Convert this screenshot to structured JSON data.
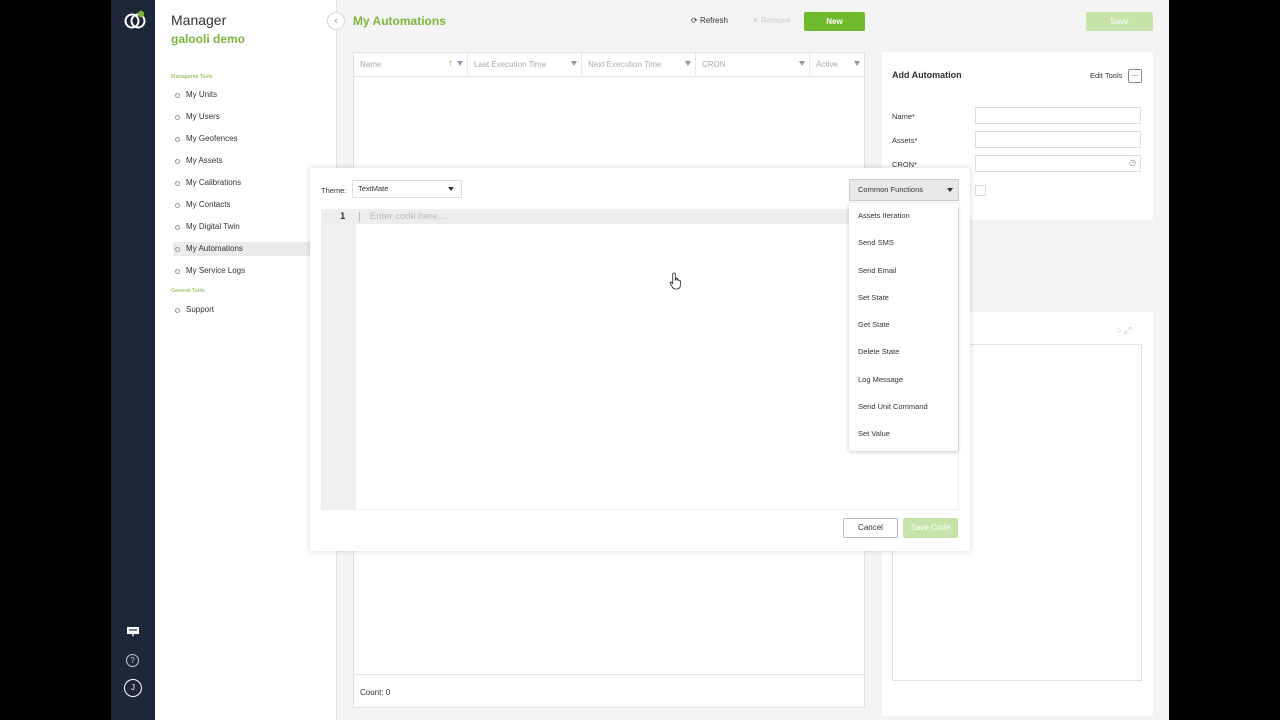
{
  "app": {
    "title": "Manager",
    "org": "galooli demo"
  },
  "nav": {
    "section_managerial": "Managerial Tools",
    "items": [
      {
        "label": "My Units"
      },
      {
        "label": "My Users"
      },
      {
        "label": "My Geofences"
      },
      {
        "label": "My Assets"
      },
      {
        "label": "My Calibrations"
      },
      {
        "label": "My Contacts"
      },
      {
        "label": "My Digital Twin"
      },
      {
        "label": "My Automations"
      },
      {
        "label": "My Service Logs"
      }
    ],
    "section_general": "General Tools",
    "general_items": [
      {
        "label": "Support"
      }
    ],
    "active_item": "My Automations"
  },
  "rail": {
    "user_initial": "J",
    "help_glyph": "?"
  },
  "page": {
    "title": "My Automations"
  },
  "toolbar": {
    "refresh_label": "Refresh",
    "remove_label": "Remove",
    "new_label": "New",
    "save_label": "Save"
  },
  "grid": {
    "columns": [
      "Name",
      "Last Execution Time",
      "Next Execution Time",
      "CRON",
      "Active"
    ],
    "count_label": "Count: 0"
  },
  "side_panel": {
    "title": "Add Automation",
    "edit_tools_label": "Edit Tools",
    "fields": [
      {
        "label": "Name*",
        "value": ""
      },
      {
        "label": "Assets*",
        "value": ""
      },
      {
        "label": "CRON*",
        "value": ""
      }
    ]
  },
  "code_modal": {
    "theme_label": "Theme:",
    "theme_value": "TextMate",
    "functions_select": "Common Functions",
    "line_number": "1",
    "placeholder": "Enter code here...",
    "cancel_label": "Cancel",
    "save_code_label": "Save Code"
  },
  "functions_dropdown": {
    "options": [
      {
        "label": "Assets Iteration"
      },
      {
        "label": "Send SMS"
      },
      {
        "label": "Send Email"
      },
      {
        "label": "Set State"
      },
      {
        "label": "Get State"
      },
      {
        "label": "Delete State"
      },
      {
        "label": "Log Message"
      },
      {
        "label": "Send Unit Command"
      },
      {
        "label": "Set Value"
      }
    ]
  },
  "colors": {
    "brand_green": "#7cb53c",
    "button_green": "#6fba2c",
    "disabled_green": "#c6e3a9",
    "rail_dark": "#1c2739"
  }
}
